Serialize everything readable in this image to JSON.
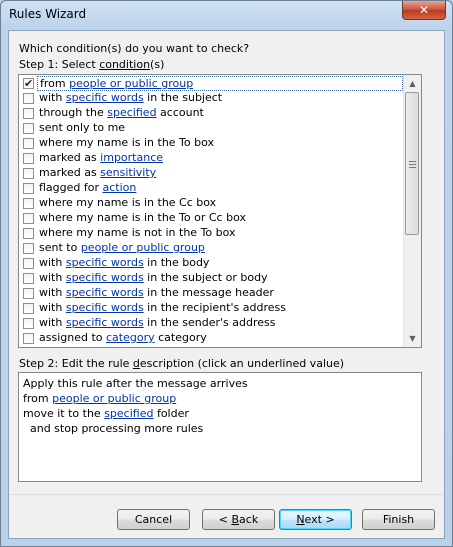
{
  "window": {
    "title": "Rules Wizard",
    "close_glyph": "✕"
  },
  "question": "Which condition(s) do you want to check?",
  "step1": {
    "prefix": "Step 1: Select ",
    "underlined": "condition",
    "suffix": "(s)"
  },
  "conditions": [
    {
      "checked": true,
      "parts": [
        {
          "t": "from "
        },
        {
          "t": "people or public group",
          "link": true
        }
      ]
    },
    {
      "checked": false,
      "parts": [
        {
          "t": "with "
        },
        {
          "t": "specific words",
          "link": true
        },
        {
          "t": " in the subject"
        }
      ]
    },
    {
      "checked": false,
      "parts": [
        {
          "t": "through the "
        },
        {
          "t": "specified",
          "link": true
        },
        {
          "t": " account"
        }
      ]
    },
    {
      "checked": false,
      "parts": [
        {
          "t": "sent only to me"
        }
      ]
    },
    {
      "checked": false,
      "parts": [
        {
          "t": "where my name is in the To box"
        }
      ]
    },
    {
      "checked": false,
      "parts": [
        {
          "t": "marked as "
        },
        {
          "t": "importance",
          "link": true
        }
      ]
    },
    {
      "checked": false,
      "parts": [
        {
          "t": "marked as "
        },
        {
          "t": "sensitivity",
          "link": true
        }
      ]
    },
    {
      "checked": false,
      "parts": [
        {
          "t": "flagged for "
        },
        {
          "t": "action",
          "link": true
        }
      ]
    },
    {
      "checked": false,
      "parts": [
        {
          "t": "where my name is in the Cc box"
        }
      ]
    },
    {
      "checked": false,
      "parts": [
        {
          "t": "where my name is in the To or Cc box"
        }
      ]
    },
    {
      "checked": false,
      "parts": [
        {
          "t": "where my name is not in the To box"
        }
      ]
    },
    {
      "checked": false,
      "parts": [
        {
          "t": "sent to "
        },
        {
          "t": "people or public group",
          "link": true
        }
      ]
    },
    {
      "checked": false,
      "parts": [
        {
          "t": "with "
        },
        {
          "t": "specific words",
          "link": true
        },
        {
          "t": " in the body"
        }
      ]
    },
    {
      "checked": false,
      "parts": [
        {
          "t": "with "
        },
        {
          "t": "specific words",
          "link": true
        },
        {
          "t": " in the subject or body"
        }
      ]
    },
    {
      "checked": false,
      "parts": [
        {
          "t": "with "
        },
        {
          "t": "specific words",
          "link": true
        },
        {
          "t": " in the message header"
        }
      ]
    },
    {
      "checked": false,
      "parts": [
        {
          "t": "with "
        },
        {
          "t": "specific words",
          "link": true
        },
        {
          "t": " in the recipient's address"
        }
      ]
    },
    {
      "checked": false,
      "parts": [
        {
          "t": "with "
        },
        {
          "t": "specific words",
          "link": true
        },
        {
          "t": " in the sender's address"
        }
      ]
    },
    {
      "checked": false,
      "parts": [
        {
          "t": "assigned to "
        },
        {
          "t": "category",
          "link": true
        },
        {
          "t": " category"
        }
      ]
    }
  ],
  "step2": {
    "prefix": "Step 2: Edit the rule ",
    "underlined": "d",
    "suffix": "escription (click an underlined value)"
  },
  "description": [
    {
      "parts": [
        {
          "t": "Apply this rule after the message arrives"
        }
      ]
    },
    {
      "parts": [
        {
          "t": "from "
        },
        {
          "t": "people or public group",
          "link": true
        }
      ]
    },
    {
      "parts": [
        {
          "t": "move it to the "
        },
        {
          "t": "specified",
          "link": true
        },
        {
          "t": " folder"
        }
      ]
    },
    {
      "parts": [
        {
          "t": "  and stop processing more rules"
        }
      ]
    }
  ],
  "buttons": {
    "cancel": "Cancel",
    "back": {
      "prefix": "< ",
      "underlined": "B",
      "suffix": "ack"
    },
    "next": {
      "underlined": "N",
      "suffix": "ext >"
    },
    "finish": "Finish"
  }
}
